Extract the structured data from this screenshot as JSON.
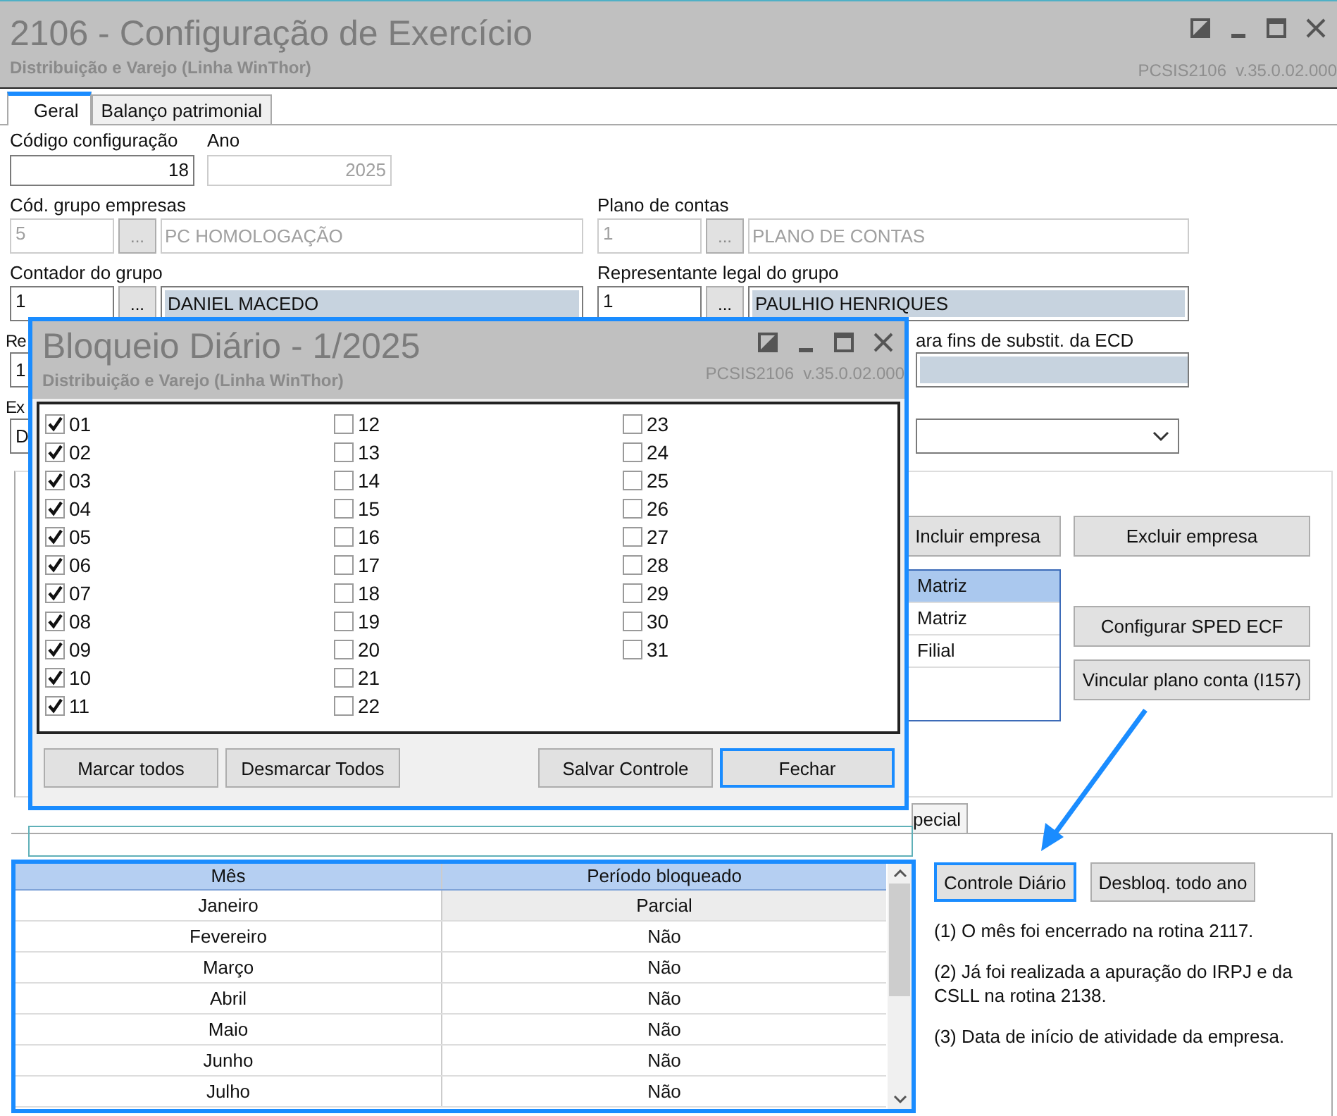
{
  "window": {
    "title": "2106 - Configuração de Exercício",
    "subtitle": "Distribuição e Varejo (Linha WinThor)",
    "version": "PCSIS2106  v.35.0.02.000"
  },
  "tabs": [
    {
      "label": "Geral",
      "selected": true
    },
    {
      "label": "Balanço patrimonial",
      "selected": false
    }
  ],
  "code_fields": [
    {
      "label": "Código configuração",
      "value": "18",
      "disabled": false
    },
    {
      "label": "Ano",
      "value": "2025",
      "disabled": true
    }
  ],
  "lookup_rows": [
    [
      {
        "label": "Cód. grupo empresas",
        "code": "5",
        "button": "...",
        "name": "PC HOMOLOGAÇÃO",
        "disabled": true
      },
      {
        "label": "Plano de contas",
        "code": "1",
        "button": "...",
        "name": "PLANO DE CONTAS",
        "disabled": true
      }
    ],
    [
      {
        "label": "Contador do grupo",
        "code": "1",
        "button": "...",
        "name": "DANIEL MACEDO",
        "disabled": false
      },
      {
        "label": "Representante legal do grupo",
        "code": "1",
        "button": "...",
        "name": "PAULHIO HENRIQUES",
        "disabled": false
      }
    ]
  ],
  "partial_rows": [
    {
      "left": {
        "label": "Re",
        "value": "1"
      },
      "right": {
        "kind": "field",
        "label": "ara fins de substit. da ECD"
      }
    },
    {
      "left": {
        "label": "Ex",
        "value": "D"
      },
      "right": {
        "kind": "dropdown"
      }
    }
  ],
  "company_panel": {
    "buttons": [
      "Incluir empresa",
      "Excluir empresa",
      "Configurar SPED ECF",
      "Vincular plano conta (I157)"
    ],
    "grid_rows": [
      {
        "value": "Matriz",
        "selected": true
      },
      {
        "value": "Matriz",
        "selected": false
      },
      {
        "value": "Filial",
        "selected": false
      }
    ]
  },
  "lower_tab": {
    "label": "pecial"
  },
  "month_table": {
    "columns": [
      "Mês",
      "Período bloqueado"
    ],
    "rows": [
      {
        "month": "Janeiro",
        "status": "Parcial",
        "selected": true
      },
      {
        "month": "Fevereiro",
        "status": "Não",
        "selected": false
      },
      {
        "month": "Março",
        "status": "Não",
        "selected": false
      },
      {
        "month": "Abril",
        "status": "Não",
        "selected": false
      },
      {
        "month": "Maio",
        "status": "Não",
        "selected": false
      },
      {
        "month": "Junho",
        "status": "Não",
        "selected": false
      },
      {
        "month": "Julho",
        "status": "Não",
        "selected": false
      }
    ]
  },
  "actions": [
    {
      "label": "Controle Diário",
      "focused": true
    },
    {
      "label": "Desbloq. todo ano",
      "focused": false
    }
  ],
  "notes": [
    "(1)  O mês foi encerrado na rotina 2117.",
    "(2)  Já foi realizada a apuração do IRPJ e da CSLL na rotina 2138.",
    "(3)  Data de início de atividade da empresa."
  ],
  "dialog": {
    "title": "Bloqueio Diário - 1/2025",
    "subtitle": "Distribuição e Varejo (Linha WinThor)",
    "version": "PCSIS2106  v.35.0.02.000",
    "days": [
      {
        "label": "01",
        "checked": true
      },
      {
        "label": "02",
        "checked": true
      },
      {
        "label": "03",
        "checked": true
      },
      {
        "label": "04",
        "checked": true
      },
      {
        "label": "05",
        "checked": true
      },
      {
        "label": "06",
        "checked": true
      },
      {
        "label": "07",
        "checked": true
      },
      {
        "label": "08",
        "checked": true
      },
      {
        "label": "09",
        "checked": true
      },
      {
        "label": "10",
        "checked": true
      },
      {
        "label": "11",
        "checked": true
      },
      {
        "label": "12",
        "checked": false
      },
      {
        "label": "13",
        "checked": false
      },
      {
        "label": "14",
        "checked": false
      },
      {
        "label": "15",
        "checked": false
      },
      {
        "label": "16",
        "checked": false
      },
      {
        "label": "17",
        "checked": false
      },
      {
        "label": "18",
        "checked": false
      },
      {
        "label": "19",
        "checked": false
      },
      {
        "label": "20",
        "checked": false
      },
      {
        "label": "21",
        "checked": false
      },
      {
        "label": "22",
        "checked": false
      },
      {
        "label": "23",
        "checked": false
      },
      {
        "label": "24",
        "checked": false
      },
      {
        "label": "25",
        "checked": false
      },
      {
        "label": "26",
        "checked": false
      },
      {
        "label": "27",
        "checked": false
      },
      {
        "label": "28",
        "checked": false
      },
      {
        "label": "29",
        "checked": false
      },
      {
        "label": "30",
        "checked": false
      },
      {
        "label": "31",
        "checked": false
      }
    ],
    "buttons": [
      {
        "label": "Marcar todos",
        "focused": false
      },
      {
        "label": "Desmarcar Todos",
        "focused": false
      },
      {
        "label": "Salvar Controle",
        "focused": false
      },
      {
        "label": "Fechar",
        "focused": true
      }
    ]
  }
}
